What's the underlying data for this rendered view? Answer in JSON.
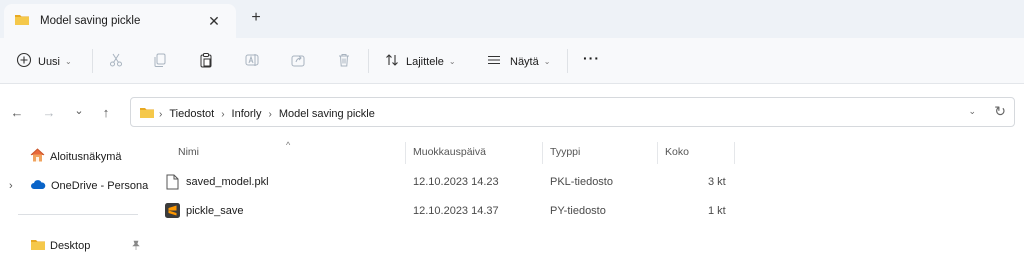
{
  "tab": {
    "title": "Model saving pickle",
    "close": "✕",
    "new_tab": "+"
  },
  "toolbar": {
    "new_label": "Uusi",
    "sort_label": "Lajittele",
    "view_label": "Näytä",
    "more": "···"
  },
  "nav": {
    "back": "←",
    "forward": "→",
    "recent": "⌄",
    "up": "↑"
  },
  "address": {
    "crumbs": [
      "Tiedostot",
      "Inforly",
      "Model saving pickle"
    ],
    "separator": "›",
    "lead_separator": "›",
    "dropdown": "⌄",
    "refresh": "↻"
  },
  "sidebar": {
    "home": "Aloitusnäkymä",
    "onedrive": "OneDrive - Persona",
    "desktop": "Desktop",
    "expand": "›",
    "pin": "📌"
  },
  "columns": {
    "name": "Nimi",
    "modified": "Muokkauspäivä",
    "type": "Tyyppi",
    "size": "Koko",
    "sort_indicator": "^"
  },
  "files": [
    {
      "name": "saved_model.pkl",
      "modified": "12.10.2023 14.23",
      "type": "PKL-tiedosto",
      "size": "3 kt",
      "icon": "document-icon"
    },
    {
      "name": "pickle_save",
      "modified": "12.10.2023 14.37",
      "type": "PY-tiedosto",
      "size": "1 kt",
      "icon": "sublime-text-icon"
    }
  ],
  "colors": {
    "folder": "#f2c243",
    "accent": "#0067c0",
    "onedrive": "#0a64c8",
    "home": "#e9693a"
  }
}
